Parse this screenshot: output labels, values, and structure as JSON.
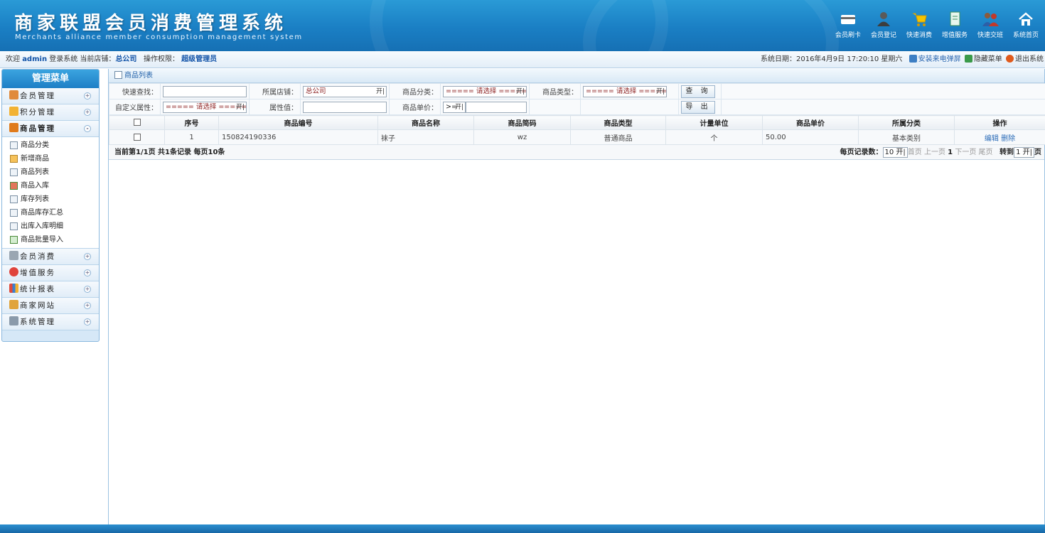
{
  "header": {
    "title": "商家联盟会员消费管理系统",
    "subtitle": "Merchants alliance member consumption management system",
    "toolbar": [
      {
        "label": "会员刷卡",
        "icon": "card-icon"
      },
      {
        "label": "会员登记",
        "icon": "user-icon"
      },
      {
        "label": "快速消费",
        "icon": "cart-icon"
      },
      {
        "label": "增值服务",
        "icon": "document-icon"
      },
      {
        "label": "快速交班",
        "icon": "handover-icon"
      },
      {
        "label": "系统首页",
        "icon": "home-icon"
      }
    ],
    "colors": {
      "header_bg": "#1a7fc4",
      "accent": "#1253a8"
    }
  },
  "infobar": {
    "welcome": "欢迎",
    "user": "admin",
    "login_text": "登录系统 当前店铺：",
    "store": "总公司",
    "perm_label": "操作权限：",
    "perm": "超级管理员",
    "date_text": "系统日期：2016年4月9日 17:20:10 星期六",
    "install_link": "安装来电弹屏",
    "hide_menu": "隐藏菜单",
    "logout": "退出系统"
  },
  "sidebar": {
    "title": "管理菜单",
    "groups": [
      {
        "label": "会员管理",
        "toggle": "+"
      },
      {
        "label": "积分管理",
        "toggle": "+"
      },
      {
        "label": "商品管理",
        "toggle": "-"
      },
      {
        "label": "会员消费",
        "toggle": "+"
      },
      {
        "label": "增值服务",
        "toggle": "+"
      },
      {
        "label": "统计报表",
        "toggle": "+"
      },
      {
        "label": "商家网站",
        "toggle": "+"
      },
      {
        "label": "系统管理",
        "toggle": "+"
      }
    ],
    "sub_items": [
      "商品分类",
      "新增商品",
      "商品列表",
      "商品入库",
      "库存列表",
      "商品库存汇总",
      "出库入库明细",
      "商品批量导入"
    ]
  },
  "main": {
    "page_title": "商品列表",
    "search": {
      "quick_label": "快速查找：",
      "quick_value": "",
      "store_label": "所属店铺：",
      "store_value": "总公司",
      "category_label": "商品分类：",
      "category_value": "===== 请选择 =====",
      "type_label": "商品类型：",
      "type_value": "===== 请选择 =====",
      "query_btn": "查 询",
      "custom_attr_label": "自定义属性：",
      "custom_attr_value": "===== 请选择 =====",
      "attr_value_label": "属性值：",
      "attr_value": "",
      "price_label": "商品单价：",
      "price_op": ">=",
      "price_value": "",
      "export_btn": "导 出"
    },
    "table": {
      "headers": [
        "序号",
        "商品编号",
        "商品名称",
        "商品简码",
        "商品类型",
        "计量单位",
        "商品单价",
        "所属分类",
        "操作"
      ],
      "rows": [
        {
          "index": "1",
          "code": "150824190336",
          "name": "袜子",
          "short_code": "wz",
          "type": "普通商品",
          "unit": "个",
          "price": "50.00",
          "category": "基本类别",
          "edit": "编辑",
          "delete": "删除"
        }
      ]
    },
    "pager": {
      "summary": "当前第1/1页 共1条记录 每页10条",
      "per_page_label": "每页记录数：",
      "per_page": "10",
      "first": "首页",
      "prev": "上一页",
      "current": "1",
      "next": "下一页",
      "last": "尾页",
      "goto_label": "转到",
      "goto_value": "1",
      "page_suffix": "页"
    }
  }
}
